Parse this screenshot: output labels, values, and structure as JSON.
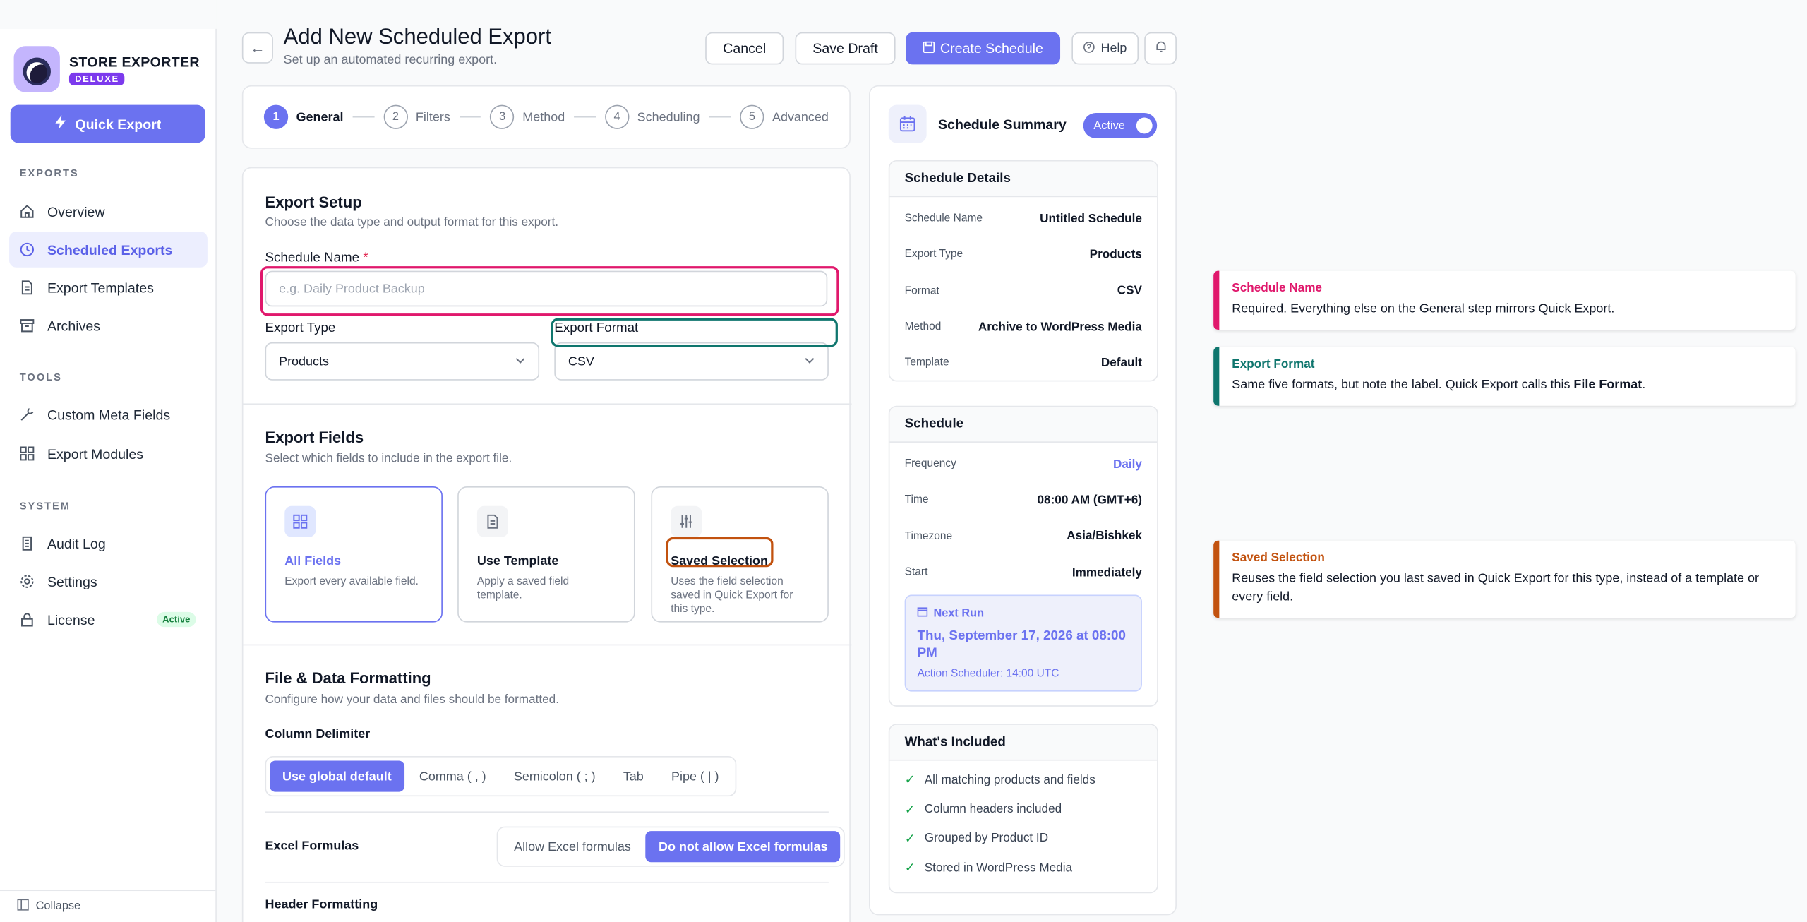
{
  "brand": {
    "name": "STORE EXPORTER",
    "badge": "DELUXE"
  },
  "sidebar": {
    "quick_export": "Quick Export",
    "sections": [
      "EXPORTS",
      "TOOLS",
      "SYSTEM"
    ],
    "items": [
      {
        "label": "Overview",
        "icon": "home-icon"
      },
      {
        "label": "Scheduled Exports",
        "icon": "clock-icon",
        "active": true
      },
      {
        "label": "Export Templates",
        "icon": "document-icon"
      },
      {
        "label": "Archives",
        "icon": "archive-icon"
      },
      {
        "label": "Custom Meta Fields",
        "icon": "wrench-icon"
      },
      {
        "label": "Export Modules",
        "icon": "grid-icon"
      },
      {
        "label": "Audit Log",
        "icon": "log-icon"
      },
      {
        "label": "Settings",
        "icon": "gear-icon"
      },
      {
        "label": "License",
        "icon": "lock-icon",
        "badge": "Active"
      }
    ],
    "collapse": "Collapse"
  },
  "header": {
    "title": "Add New Scheduled Export",
    "subtitle": "Set up an automated recurring export.",
    "cancel": "Cancel",
    "save_draft": "Save Draft",
    "create": "Create Schedule",
    "help": "Help"
  },
  "steps": [
    {
      "num": "1",
      "label": "General"
    },
    {
      "num": "2",
      "label": "Filters"
    },
    {
      "num": "3",
      "label": "Method"
    },
    {
      "num": "4",
      "label": "Scheduling"
    },
    {
      "num": "5",
      "label": "Advanced"
    }
  ],
  "setup": {
    "title": "Export Setup",
    "subtitle": "Choose the data type and output format for this export.",
    "name_label": "Schedule Name",
    "name_req": "*",
    "name_placeholder": "e.g. Daily Product Backup",
    "type_label": "Export Type",
    "type_value": "Products",
    "format_label": "Export Format",
    "format_value": "CSV"
  },
  "fields": {
    "title": "Export Fields",
    "subtitle": "Select which fields to include in the export file.",
    "options": [
      {
        "title": "All Fields",
        "desc": "Export every available field."
      },
      {
        "title": "Use Template",
        "desc": "Apply a saved field template."
      },
      {
        "title": "Saved Selection",
        "desc": "Uses the field selection saved in Quick Export for this type."
      }
    ]
  },
  "formatting": {
    "title": "File & Data Formatting",
    "subtitle": "Configure how your data and files should be formatted.",
    "delimiter_label": "Column Delimiter",
    "delimiters": [
      "Use global default",
      "Comma ( , )",
      "Semicolon ( ; )",
      "Tab",
      "Pipe ( | )"
    ],
    "excel_label": "Excel Formulas",
    "excel_options": [
      "Allow Excel formulas",
      "Do not allow Excel formulas"
    ],
    "header_label": "Header Formatting"
  },
  "summary": {
    "title": "Schedule Summary",
    "toggle": "Active",
    "details_title": "Schedule Details",
    "details": [
      {
        "k": "Schedule Name",
        "v": "Untitled Schedule"
      },
      {
        "k": "Export Type",
        "v": "Products"
      },
      {
        "k": "Format",
        "v": "CSV"
      },
      {
        "k": "Method",
        "v": "Archive to WordPress Media"
      },
      {
        "k": "Template",
        "v": "Default"
      }
    ],
    "schedule_title": "Schedule",
    "schedule": [
      {
        "k": "Frequency",
        "v": "Daily"
      },
      {
        "k": "Time",
        "v": "08:00 AM (GMT+6)"
      },
      {
        "k": "Timezone",
        "v": "Asia/Bishkek"
      },
      {
        "k": "Start",
        "v": "Immediately"
      }
    ],
    "next_run_label": "Next Run",
    "next_run_date": "Thu, September 17, 2026 at 08:00 PM",
    "next_run_sub": "Action Scheduler: 14:00 UTC",
    "included_title": "What's Included",
    "included": [
      "All matching products and fields",
      "Column headers included",
      "Grouped by Product ID",
      "Stored in WordPress Media"
    ]
  },
  "annotations": [
    {
      "title": "Schedule Name",
      "body": "Required. Everything else on the General step mirrors Quick Export."
    },
    {
      "title": "Export Format",
      "body_pre": "Same five formats, but note the label. Quick Export calls this ",
      "body_bold": "File Format",
      "body_post": "."
    },
    {
      "title": "Saved Selection",
      "body": "Reuses the field selection you last saved in Quick Export for this type, instead of a template or every field."
    }
  ],
  "colors": {
    "accent": "#6b72f0",
    "pink": "#e0186c",
    "teal": "#0f766e",
    "orange": "#c2520f"
  }
}
